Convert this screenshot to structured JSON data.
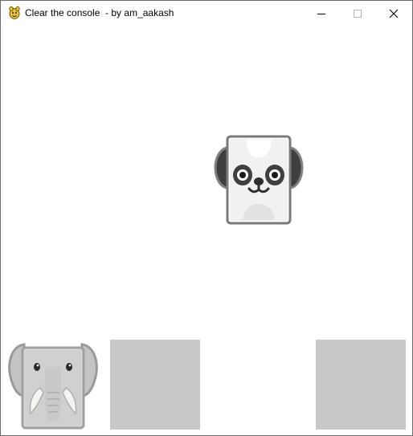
{
  "window": {
    "title": "Clear the console  - by am_aakash",
    "controls": [
      "minimize",
      "maximize",
      "close"
    ]
  },
  "canvas": {
    "background": "#ffffff",
    "falling_tile": {
      "animal": "panda",
      "icon": "panda-icon"
    },
    "tray": [
      {
        "slot": 1,
        "state": "filled",
        "animal": "elephant",
        "icon": "elephant-icon"
      },
      {
        "slot": 2,
        "state": "empty"
      },
      {
        "slot": 3,
        "state": "empty-gap"
      },
      {
        "slot": 4,
        "state": "empty"
      }
    ],
    "colors": {
      "empty_slot": "#c8c8c8",
      "panda_frame": "#7a7a7a",
      "elephant_body": "#d0d0d0"
    }
  }
}
